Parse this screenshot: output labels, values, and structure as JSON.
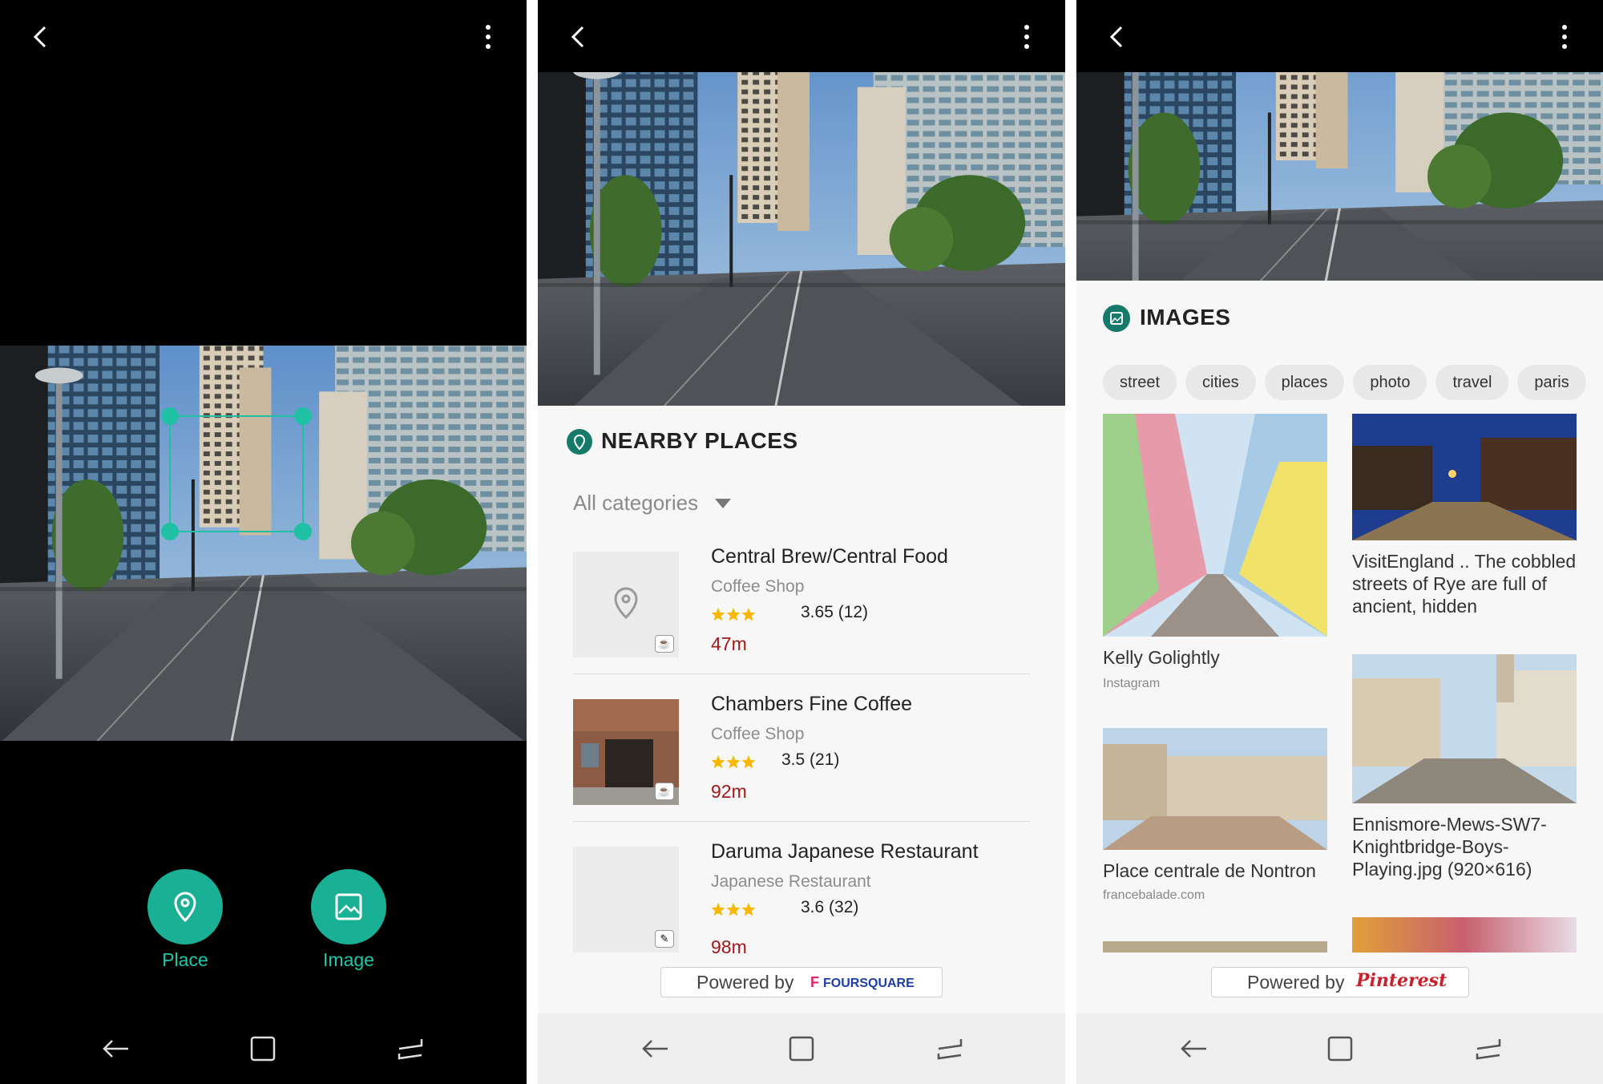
{
  "colors": {
    "accent": "#1ab096",
    "distance": "#a01818",
    "star": "#f6b800"
  },
  "panel1": {
    "actions": [
      {
        "label": "Place",
        "icon": "location-pin-icon"
      },
      {
        "label": "Image",
        "icon": "image-icon"
      }
    ]
  },
  "panel2": {
    "section_title": "NEARBY PLACES",
    "category_filter": "All categories",
    "places": [
      {
        "name": "Central Brew/Central Food",
        "category": "Coffee Shop",
        "rating": "3.65 (12)",
        "stars": 3.5,
        "distance": "47m",
        "badge_icon": "coffee-icon"
      },
      {
        "name": "Chambers Fine Coffee",
        "category": "Coffee Shop",
        "rating": "3.5 (21)",
        "stars": 3,
        "distance": "92m",
        "badge_icon": "coffee-icon"
      },
      {
        "name": "Daruma Japanese Restaurant",
        "category": "Japanese Restaurant",
        "rating": "3.6 (32)",
        "stars": 3.5,
        "distance": "98m",
        "badge_icon": "chopsticks-icon"
      }
    ],
    "powered_by": "Powered by",
    "provider": "FOURSQUARE"
  },
  "panel3": {
    "section_title": "IMAGES",
    "tags": [
      "street",
      "cities",
      "places",
      "photo",
      "travel",
      "paris"
    ],
    "images": [
      {
        "caption": "Kelly Golightly",
        "source": "Instagram"
      },
      {
        "caption": "VisitEngland     .. The cobbled streets of Rye are full of ancient, hidden",
        "source": ""
      },
      {
        "caption": "Place centrale de Nontron",
        "source": "francebalade.com"
      },
      {
        "caption": "Ennismore-Mews-SW7-Knightbridge-Boys-Playing.jpg (920×616)",
        "source": ""
      }
    ],
    "powered_by": "Powered by",
    "provider": "Pinterest"
  }
}
